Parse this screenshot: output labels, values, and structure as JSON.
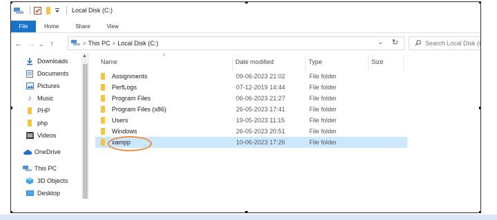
{
  "window": {
    "title": "Local Disk (C:)"
  },
  "ribbon": {
    "tabs": [
      "File",
      "Home",
      "Share",
      "View"
    ]
  },
  "address": {
    "crumbs": [
      "This PC",
      "Local Disk (C:)"
    ],
    "search_placeholder": "Search Local Disk (C:)"
  },
  "nav": {
    "items": [
      {
        "label": "Downloads",
        "icon": "download-arrow-icon",
        "pinned": true
      },
      {
        "label": "Documents",
        "icon": "documents-icon",
        "pinned": true
      },
      {
        "label": "Pictures",
        "icon": "pictures-icon",
        "pinned": true
      },
      {
        "label": "Music",
        "icon": "music-note-icon",
        "pinned": true
      },
      {
        "label": "PHP",
        "icon": "folder-icon",
        "pinned": false
      },
      {
        "label": "php",
        "icon": "folder-icon",
        "pinned": false
      },
      {
        "label": "Videos",
        "icon": "videos-icon",
        "pinned": false
      },
      {
        "label": "OneDrive",
        "icon": "cloud-icon",
        "pinned": false
      },
      {
        "label": "This PC",
        "icon": "computer-icon",
        "pinned": false
      },
      {
        "label": "3D Objects",
        "icon": "cube-icon",
        "pinned": false
      },
      {
        "label": "Desktop",
        "icon": "desktop-icon",
        "pinned": false
      }
    ]
  },
  "columns": {
    "name": "Name",
    "date": "Date modified",
    "type": "Type",
    "size": "Size"
  },
  "files": [
    {
      "name": "Assignments",
      "date": "09-06-2023 21:02",
      "type": "File folder"
    },
    {
      "name": "PerfLogs",
      "date": "07-12-2019 14:44",
      "type": "File folder"
    },
    {
      "name": "Program Files",
      "date": "06-06-2023 21:27",
      "type": "File folder"
    },
    {
      "name": "Program Files (x86)",
      "date": "26-05-2023 17:41",
      "type": "File folder"
    },
    {
      "name": "Users",
      "date": "19-05-2023 11:15",
      "type": "File folder"
    },
    {
      "name": "Windows",
      "date": "26-05-2023 20:51",
      "type": "File folder"
    },
    {
      "name": "xampp",
      "date": "10-06-2023 17:26",
      "type": "File folder",
      "selected": true
    }
  ],
  "colors": {
    "accent": "#1a73c9",
    "selection": "#cce8ff",
    "highlight": "#f08a34",
    "folder": "#f4c542"
  }
}
